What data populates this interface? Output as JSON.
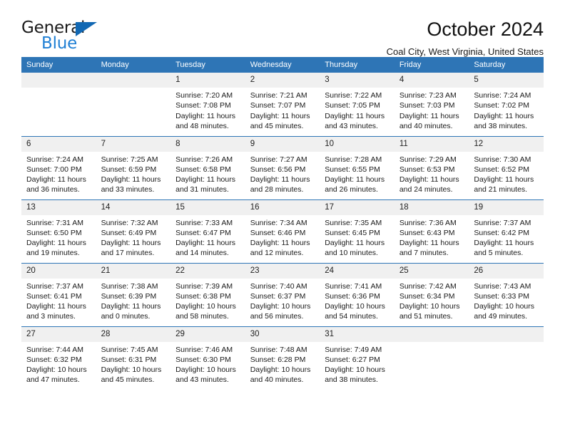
{
  "brand": {
    "line1": "General",
    "line2": "Blue",
    "triangle_color": "#1268b3",
    "blue_text_color": "#1f7fd4"
  },
  "header": {
    "title": "October 2024",
    "subtitle": "Coal City, West Virginia, United States",
    "header_bar_color": "#2e75b6",
    "daynum_band_color": "#f0f0f0"
  },
  "weekday_headers": [
    "Sunday",
    "Monday",
    "Tuesday",
    "Wednesday",
    "Thursday",
    "Friday",
    "Saturday"
  ],
  "labels": {
    "sunrise_prefix": "Sunrise:",
    "sunset_prefix": "Sunset:",
    "daylight_prefix": "Daylight:"
  },
  "weeks": [
    [
      {
        "day": "",
        "sunrise": "",
        "sunset": "",
        "daylight_line1": "",
        "daylight_line2": ""
      },
      {
        "day": "",
        "sunrise": "",
        "sunset": "",
        "daylight_line1": "",
        "daylight_line2": ""
      },
      {
        "day": "1",
        "sunrise": "Sunrise: 7:20 AM",
        "sunset": "Sunset: 7:08 PM",
        "daylight_line1": "Daylight: 11 hours",
        "daylight_line2": "and 48 minutes."
      },
      {
        "day": "2",
        "sunrise": "Sunrise: 7:21 AM",
        "sunset": "Sunset: 7:07 PM",
        "daylight_line1": "Daylight: 11 hours",
        "daylight_line2": "and 45 minutes."
      },
      {
        "day": "3",
        "sunrise": "Sunrise: 7:22 AM",
        "sunset": "Sunset: 7:05 PM",
        "daylight_line1": "Daylight: 11 hours",
        "daylight_line2": "and 43 minutes."
      },
      {
        "day": "4",
        "sunrise": "Sunrise: 7:23 AM",
        "sunset": "Sunset: 7:03 PM",
        "daylight_line1": "Daylight: 11 hours",
        "daylight_line2": "and 40 minutes."
      },
      {
        "day": "5",
        "sunrise": "Sunrise: 7:24 AM",
        "sunset": "Sunset: 7:02 PM",
        "daylight_line1": "Daylight: 11 hours",
        "daylight_line2": "and 38 minutes."
      }
    ],
    [
      {
        "day": "6",
        "sunrise": "Sunrise: 7:24 AM",
        "sunset": "Sunset: 7:00 PM",
        "daylight_line1": "Daylight: 11 hours",
        "daylight_line2": "and 36 minutes."
      },
      {
        "day": "7",
        "sunrise": "Sunrise: 7:25 AM",
        "sunset": "Sunset: 6:59 PM",
        "daylight_line1": "Daylight: 11 hours",
        "daylight_line2": "and 33 minutes."
      },
      {
        "day": "8",
        "sunrise": "Sunrise: 7:26 AM",
        "sunset": "Sunset: 6:58 PM",
        "daylight_line1": "Daylight: 11 hours",
        "daylight_line2": "and 31 minutes."
      },
      {
        "day": "9",
        "sunrise": "Sunrise: 7:27 AM",
        "sunset": "Sunset: 6:56 PM",
        "daylight_line1": "Daylight: 11 hours",
        "daylight_line2": "and 28 minutes."
      },
      {
        "day": "10",
        "sunrise": "Sunrise: 7:28 AM",
        "sunset": "Sunset: 6:55 PM",
        "daylight_line1": "Daylight: 11 hours",
        "daylight_line2": "and 26 minutes."
      },
      {
        "day": "11",
        "sunrise": "Sunrise: 7:29 AM",
        "sunset": "Sunset: 6:53 PM",
        "daylight_line1": "Daylight: 11 hours",
        "daylight_line2": "and 24 minutes."
      },
      {
        "day": "12",
        "sunrise": "Sunrise: 7:30 AM",
        "sunset": "Sunset: 6:52 PM",
        "daylight_line1": "Daylight: 11 hours",
        "daylight_line2": "and 21 minutes."
      }
    ],
    [
      {
        "day": "13",
        "sunrise": "Sunrise: 7:31 AM",
        "sunset": "Sunset: 6:50 PM",
        "daylight_line1": "Daylight: 11 hours",
        "daylight_line2": "and 19 minutes."
      },
      {
        "day": "14",
        "sunrise": "Sunrise: 7:32 AM",
        "sunset": "Sunset: 6:49 PM",
        "daylight_line1": "Daylight: 11 hours",
        "daylight_line2": "and 17 minutes."
      },
      {
        "day": "15",
        "sunrise": "Sunrise: 7:33 AM",
        "sunset": "Sunset: 6:47 PM",
        "daylight_line1": "Daylight: 11 hours",
        "daylight_line2": "and 14 minutes."
      },
      {
        "day": "16",
        "sunrise": "Sunrise: 7:34 AM",
        "sunset": "Sunset: 6:46 PM",
        "daylight_line1": "Daylight: 11 hours",
        "daylight_line2": "and 12 minutes."
      },
      {
        "day": "17",
        "sunrise": "Sunrise: 7:35 AM",
        "sunset": "Sunset: 6:45 PM",
        "daylight_line1": "Daylight: 11 hours",
        "daylight_line2": "and 10 minutes."
      },
      {
        "day": "18",
        "sunrise": "Sunrise: 7:36 AM",
        "sunset": "Sunset: 6:43 PM",
        "daylight_line1": "Daylight: 11 hours",
        "daylight_line2": "and 7 minutes."
      },
      {
        "day": "19",
        "sunrise": "Sunrise: 7:37 AM",
        "sunset": "Sunset: 6:42 PM",
        "daylight_line1": "Daylight: 11 hours",
        "daylight_line2": "and 5 minutes."
      }
    ],
    [
      {
        "day": "20",
        "sunrise": "Sunrise: 7:37 AM",
        "sunset": "Sunset: 6:41 PM",
        "daylight_line1": "Daylight: 11 hours",
        "daylight_line2": "and 3 minutes."
      },
      {
        "day": "21",
        "sunrise": "Sunrise: 7:38 AM",
        "sunset": "Sunset: 6:39 PM",
        "daylight_line1": "Daylight: 11 hours",
        "daylight_line2": "and 0 minutes."
      },
      {
        "day": "22",
        "sunrise": "Sunrise: 7:39 AM",
        "sunset": "Sunset: 6:38 PM",
        "daylight_line1": "Daylight: 10 hours",
        "daylight_line2": "and 58 minutes."
      },
      {
        "day": "23",
        "sunrise": "Sunrise: 7:40 AM",
        "sunset": "Sunset: 6:37 PM",
        "daylight_line1": "Daylight: 10 hours",
        "daylight_line2": "and 56 minutes."
      },
      {
        "day": "24",
        "sunrise": "Sunrise: 7:41 AM",
        "sunset": "Sunset: 6:36 PM",
        "daylight_line1": "Daylight: 10 hours",
        "daylight_line2": "and 54 minutes."
      },
      {
        "day": "25",
        "sunrise": "Sunrise: 7:42 AM",
        "sunset": "Sunset: 6:34 PM",
        "daylight_line1": "Daylight: 10 hours",
        "daylight_line2": "and 51 minutes."
      },
      {
        "day": "26",
        "sunrise": "Sunrise: 7:43 AM",
        "sunset": "Sunset: 6:33 PM",
        "daylight_line1": "Daylight: 10 hours",
        "daylight_line2": "and 49 minutes."
      }
    ],
    [
      {
        "day": "27",
        "sunrise": "Sunrise: 7:44 AM",
        "sunset": "Sunset: 6:32 PM",
        "daylight_line1": "Daylight: 10 hours",
        "daylight_line2": "and 47 minutes."
      },
      {
        "day": "28",
        "sunrise": "Sunrise: 7:45 AM",
        "sunset": "Sunset: 6:31 PM",
        "daylight_line1": "Daylight: 10 hours",
        "daylight_line2": "and 45 minutes."
      },
      {
        "day": "29",
        "sunrise": "Sunrise: 7:46 AM",
        "sunset": "Sunset: 6:30 PM",
        "daylight_line1": "Daylight: 10 hours",
        "daylight_line2": "and 43 minutes."
      },
      {
        "day": "30",
        "sunrise": "Sunrise: 7:48 AM",
        "sunset": "Sunset: 6:28 PM",
        "daylight_line1": "Daylight: 10 hours",
        "daylight_line2": "and 40 minutes."
      },
      {
        "day": "31",
        "sunrise": "Sunrise: 7:49 AM",
        "sunset": "Sunset: 6:27 PM",
        "daylight_line1": "Daylight: 10 hours",
        "daylight_line2": "and 38 minutes."
      },
      {
        "day": "",
        "sunrise": "",
        "sunset": "",
        "daylight_line1": "",
        "daylight_line2": ""
      },
      {
        "day": "",
        "sunrise": "",
        "sunset": "",
        "daylight_line1": "",
        "daylight_line2": ""
      }
    ]
  ]
}
